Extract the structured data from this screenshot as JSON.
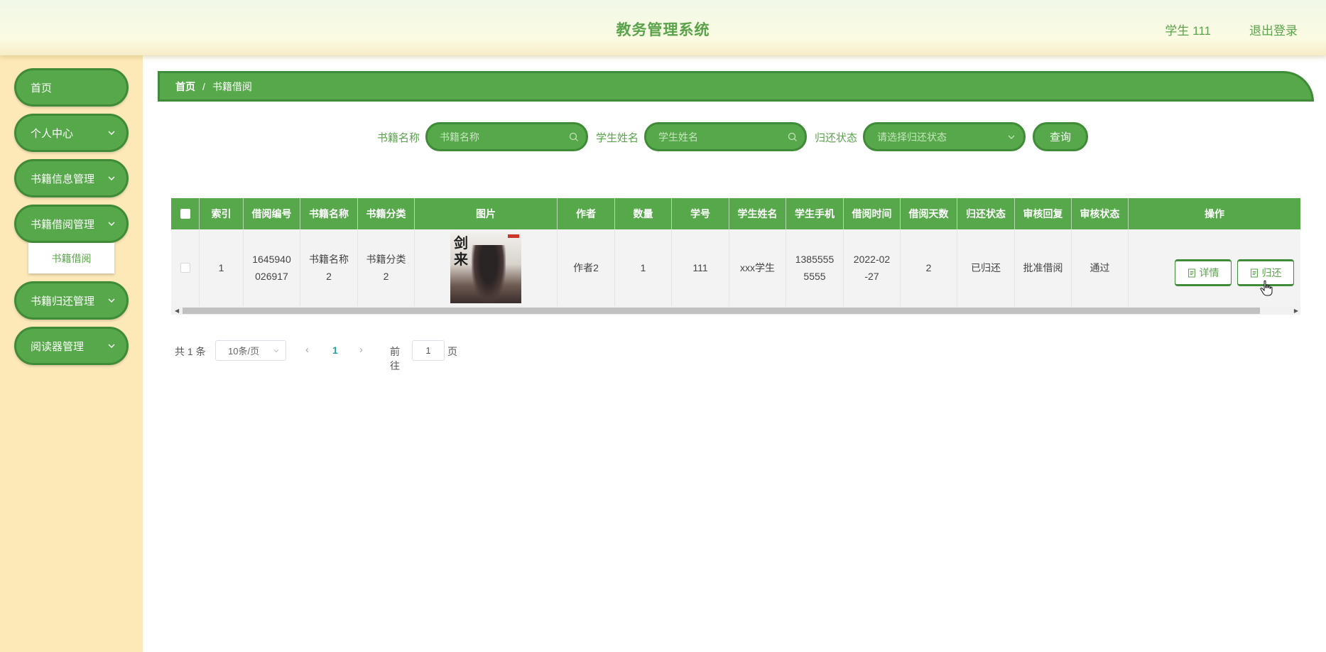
{
  "header": {
    "title": "教务管理系统",
    "user": "学生 111",
    "logout": "退出登录"
  },
  "sidebar": {
    "items": [
      {
        "label": "首页"
      },
      {
        "label": "个人中心"
      },
      {
        "label": "书籍信息管理"
      },
      {
        "label": "书籍借阅管理"
      },
      {
        "label": "书籍归还管理"
      },
      {
        "label": "阅读器管理"
      }
    ],
    "submenu": {
      "label": "书籍借阅"
    }
  },
  "breadcrumb": {
    "home": "首页",
    "separator": "/",
    "current": "书籍借阅"
  },
  "search": {
    "book_name_label": "书籍名称",
    "book_name_placeholder": "书籍名称",
    "student_name_label": "学生姓名",
    "student_name_placeholder": "学生姓名",
    "return_status_label": "归还状态",
    "return_status_placeholder": "请选择归还状态",
    "query_button": "查询"
  },
  "table": {
    "columns": [
      "索引",
      "借阅编号",
      "书籍名称",
      "书籍分类",
      "图片",
      "作者",
      "数量",
      "学号",
      "学生姓名",
      "学生手机",
      "借阅时间",
      "借阅天数",
      "归还状态",
      "审核回复",
      "审核状态",
      "操作"
    ],
    "rows": [
      {
        "index": "1",
        "borrow_no_l1": "1645940",
        "borrow_no_l2": "026917",
        "book_name_l1": "书籍名称",
        "book_name_l2": "2",
        "category_l1": "书籍分类",
        "category_l2": "2",
        "cover_text": "剑来",
        "author": "作者2",
        "quantity": "1",
        "student_id": "111",
        "student_name": "xxx学生",
        "phone_l1": "1385555",
        "phone_l2": "5555",
        "borrow_time_l1": "2022-02",
        "borrow_time_l2": "-27",
        "days": "2",
        "return_status": "已归还",
        "review_reply": "批准借阅",
        "review_status": "通过",
        "detail_button": "详情",
        "return_button": "归还"
      }
    ]
  },
  "pagination": {
    "total": "共 1 条",
    "page_size": "10条/页",
    "current_page": "1",
    "goto_label": "前往",
    "goto_value": "1",
    "page_label": "页"
  },
  "colors": {
    "primary": "#56a84a",
    "primary_dark": "#3f8b37",
    "sidebar_bg": "#fde9b8",
    "title": "#5aa34b"
  }
}
